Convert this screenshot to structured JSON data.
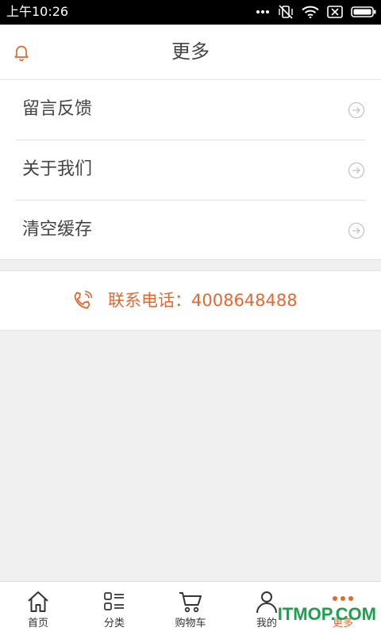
{
  "status_bar": {
    "time": "上午10:26"
  },
  "header": {
    "title": "更多"
  },
  "menu": {
    "items": [
      {
        "label": "留言反馈"
      },
      {
        "label": "关于我们"
      },
      {
        "label": "清空缓存"
      }
    ]
  },
  "contact": {
    "text": "联系电话：4008648488"
  },
  "bottom_nav": {
    "items": [
      {
        "label": "首页",
        "icon": "home-icon"
      },
      {
        "label": "分类",
        "icon": "category-icon"
      },
      {
        "label": "购物车",
        "icon": "cart-icon"
      },
      {
        "label": "我的",
        "icon": "user-icon"
      },
      {
        "label": "更多",
        "icon": "more-icon",
        "active": true
      }
    ]
  },
  "watermark": "ITMOP.COM",
  "colors": {
    "accent": "#e8672e",
    "background": "#f0f0f0",
    "watermark": "#17a34a"
  }
}
